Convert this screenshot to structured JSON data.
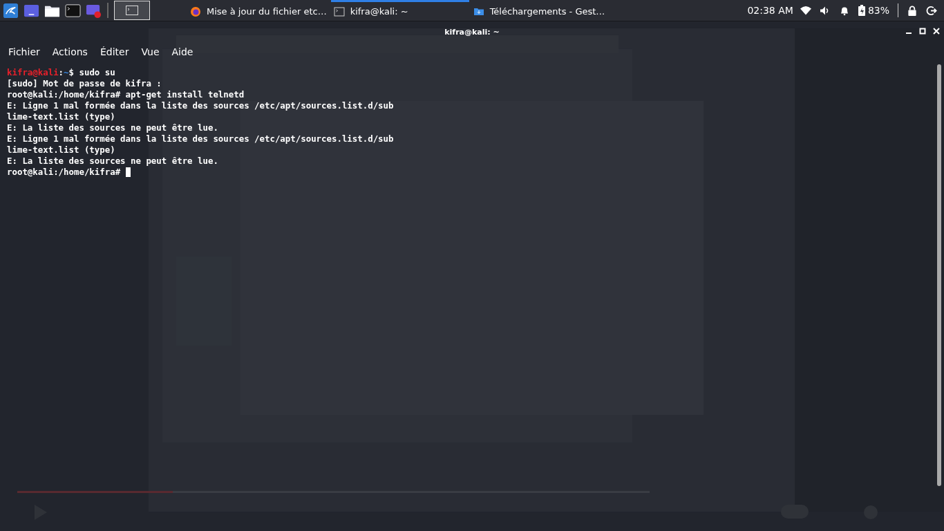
{
  "taskbar": {
    "launchers": [
      {
        "kind": "kali"
      },
      {
        "kind": "desktop"
      },
      {
        "kind": "files"
      },
      {
        "kind": "terminal"
      },
      {
        "kind": "recorder"
      }
    ],
    "workspace": {
      "selected": true
    },
    "tasks": [
      {
        "kind": "browser",
        "title": "Mise à jour du fichier etc…",
        "selected": false
      },
      {
        "kind": "terminal",
        "title": "kifra@kali: ~",
        "selected": true
      },
      {
        "kind": "folder",
        "title": "Téléchargements - Gest…",
        "selected": false
      }
    ],
    "clock": "02:38 AM",
    "battery": "83%"
  },
  "window": {
    "title": "kifra@kali: ~",
    "menu": [
      "Fichier",
      "Actions",
      "Éditer",
      "Vue",
      "Aide"
    ],
    "lines": [
      [
        {
          "kind": "user",
          "text": "kifra@kali"
        },
        {
          "kind": "plain",
          "text": ":"
        },
        {
          "kind": "path",
          "text": "~"
        },
        {
          "kind": "plain",
          "text": "$ sudo su"
        }
      ],
      [
        {
          "kind": "plain",
          "text": "[sudo] Mot de passe de kifra :"
        }
      ],
      [
        {
          "kind": "plain",
          "text": "root@kali:/home/kifra# apt-get install telnetd"
        }
      ],
      [
        {
          "kind": "plain",
          "text": "E: Ligne 1 mal formée dans la liste des sources /etc/apt/sources.list.d/sub"
        }
      ],
      [
        {
          "kind": "plain",
          "text": "lime-text.list (type)"
        }
      ],
      [
        {
          "kind": "plain",
          "text": "E: La liste des sources ne peut être lue."
        }
      ],
      [
        {
          "kind": "plain",
          "text": "E: Ligne 1 mal formée dans la liste des sources /etc/apt/sources.list.d/sub"
        }
      ],
      [
        {
          "kind": "plain",
          "text": "lime-text.list (type)"
        }
      ],
      [
        {
          "kind": "plain",
          "text": "E: La liste des sources ne peut être lue."
        }
      ],
      [
        {
          "kind": "plain",
          "text": "root@kali:/home/kifra# "
        }
      ]
    ],
    "cursor": true
  }
}
